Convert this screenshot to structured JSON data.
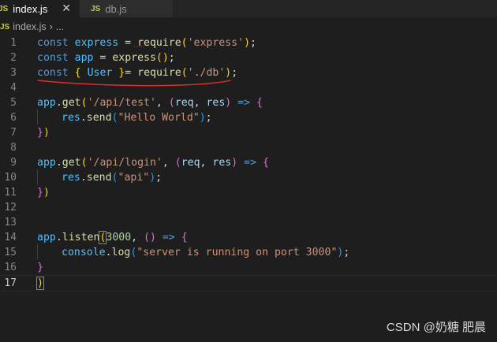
{
  "tabs": [
    {
      "badge": "JS",
      "label": "index.js",
      "close": "✕"
    },
    {
      "badge": "JS",
      "label": "db.js"
    }
  ],
  "breadcrumb": {
    "badge": "JS",
    "file": "index.js",
    "sep": "›",
    "more": "..."
  },
  "line_numbers": [
    "1",
    "2",
    "3",
    "4",
    "5",
    "6",
    "7",
    "8",
    "9",
    "10",
    "11",
    "12",
    "13",
    "14",
    "15",
    "16",
    "17"
  ],
  "code": {
    "l1": {
      "kw": "const",
      "name": "express",
      "eq": " = ",
      "fn": "require",
      "open": "(",
      "str": "'express'",
      "close": ")",
      "semi": ";"
    },
    "l2": {
      "kw": "const",
      "name": "app",
      "eq": " = ",
      "fn": "express",
      "call": "()",
      "semi": ";"
    },
    "l3": {
      "kw": "const",
      "open": "{",
      "name": "User",
      "close": "}",
      "eq": "= ",
      "fn": "require",
      "popen": "(",
      "str": "'./db'",
      "pclose": ")",
      "semi": ";"
    },
    "l5": {
      "obj": "app",
      "dot": ".",
      "fn": "get",
      "open": "(",
      "str": "'/api/test'",
      "comma": ", ",
      "popen": "(",
      "p1": "req",
      "sep": ", ",
      "p2": "res",
      "pclose": ")",
      "arrow": " => ",
      "bopen": "{"
    },
    "l6": {
      "obj": "res",
      "dot": ".",
      "fn": "send",
      "open": "(",
      "str": "\"Hello World\"",
      "close": ")",
      "semi": ";"
    },
    "l7": {
      "bclose": "}",
      "pclose": ")"
    },
    "l9": {
      "obj": "app",
      "dot": ".",
      "fn": "get",
      "open": "(",
      "str": "'/api/login'",
      "comma": ", ",
      "popen": "(",
      "p1": "req",
      "sep": ", ",
      "p2": "res",
      "pclose": ")",
      "arrow": " => ",
      "bopen": "{"
    },
    "l10": {
      "obj": "res",
      "dot": ".",
      "fn": "send",
      "open": "(",
      "str": "\"api\"",
      "close": ")",
      "semi": ";"
    },
    "l11": {
      "bclose": "}",
      "pclose": ")"
    },
    "l14": {
      "obj": "app",
      "dot": ".",
      "fn": "listen",
      "open": "(",
      "num": "3000",
      "comma": ", ",
      "popen": "()",
      "arrow": " => ",
      "bopen": "{"
    },
    "l15": {
      "obj": "console",
      "dot": ".",
      "fn": "log",
      "open": "(",
      "str": "\"server is running on port 3000\"",
      "close": ")",
      "semi": ";"
    },
    "l16": {
      "bclose": "}"
    },
    "l17": {
      "pclose": ")"
    }
  },
  "watermark": "CSDN @奶糖 肥晨",
  "colors": {
    "annotation": "#d9322c",
    "keyword": "#569cd6",
    "string": "#ce9178",
    "function": "#dcdcaa"
  }
}
